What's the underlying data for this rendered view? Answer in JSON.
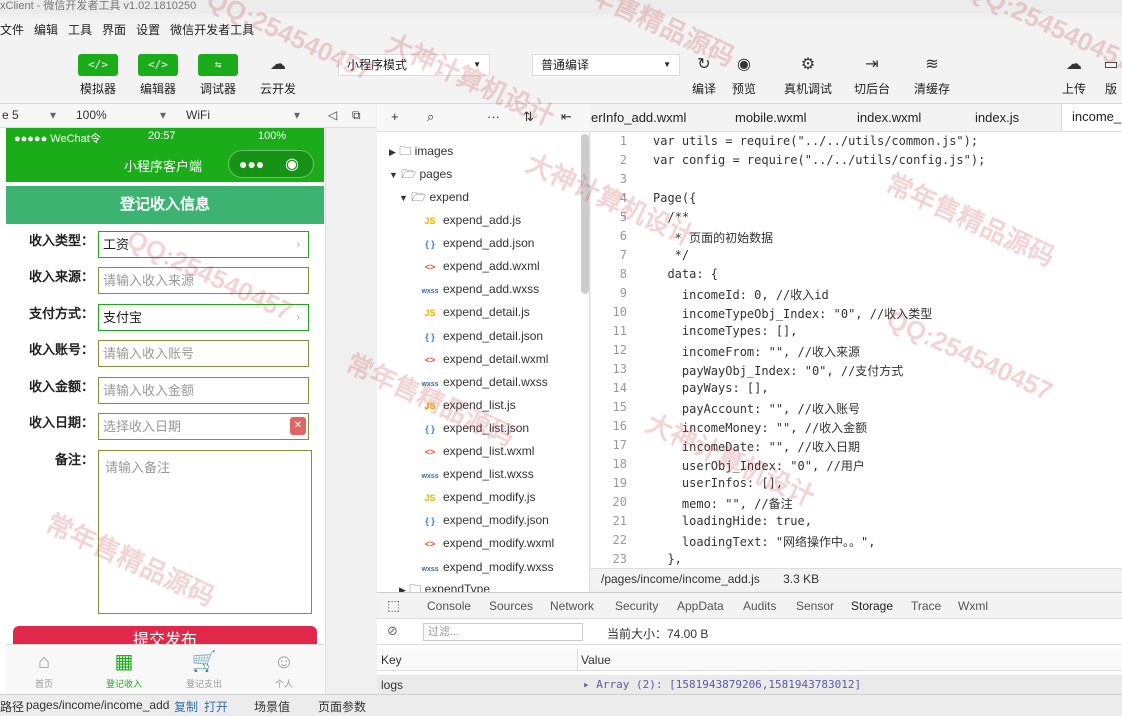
{
  "window": {
    "title": "xClient - 微信开发者工具 v1.02.1810250"
  },
  "menu": [
    "文件",
    "编辑",
    "工具",
    "界面",
    "设置",
    "微信开发者工具"
  ],
  "toolbar": {
    "buttons_left": [
      {
        "icon": "</>",
        "label": "模拟器"
      },
      {
        "icon": "</>",
        "label": "编辑器"
      },
      {
        "icon": "⇆",
        "label": "调试器"
      },
      {
        "icon": "☁",
        "label": "云开发"
      }
    ],
    "mode_select": "小程序模式",
    "compile_select": "普通编译",
    "buttons_right": [
      {
        "icon": "↻",
        "label": "编译"
      },
      {
        "icon": "◉",
        "label": "预览"
      },
      {
        "icon": "⚙",
        "label": "真机调试"
      },
      {
        "icon": "⇥",
        "label": "切后台"
      },
      {
        "icon": "≋",
        "label": "清缓存"
      },
      {
        "icon": "☁",
        "label": "上传"
      },
      {
        "icon": "",
        "label": "版"
      }
    ]
  },
  "device_bar": {
    "device": "e 5",
    "zoom": "100%",
    "network": "WiFi"
  },
  "simulator": {
    "status_left": "●●●●● WeChat令",
    "status_time": "20:57",
    "status_right": "100%",
    "nav_title": "小程序客户端",
    "header": "登记收入信息",
    "fields": [
      {
        "label": "收入类型：",
        "value": "工资",
        "placeholder": false,
        "arrow": true
      },
      {
        "label": "收入来源：",
        "value": "请输入收入来源",
        "placeholder": true,
        "arrow": false
      },
      {
        "label": "支付方式：",
        "value": "支付宝",
        "placeholder": false,
        "arrow": true
      },
      {
        "label": "收入账号：",
        "value": "请输入收入账号",
        "placeholder": true,
        "arrow": false
      },
      {
        "label": "收入金额：",
        "value": "请输入收入金额",
        "placeholder": true,
        "arrow": false
      },
      {
        "label": "收入日期：",
        "value": "选择收入日期",
        "placeholder": true,
        "arrow": false
      }
    ],
    "memo_label": "备注：",
    "memo_placeholder": "请输入备注",
    "submit": "提交发布",
    "tabs": [
      {
        "label": "首页",
        "icon": "⌂"
      },
      {
        "label": "登记收入",
        "icon": "▦"
      },
      {
        "label": "登记支出",
        "icon": "🛒"
      },
      {
        "label": "个人",
        "icon": "☺"
      }
    ]
  },
  "tree": {
    "toolbar": [
      "+",
      "⌕",
      "···",
      "⇅",
      "⇤"
    ],
    "folders": [
      {
        "name": "images",
        "open": false
      },
      {
        "name": "pages",
        "open": true
      },
      {
        "name": "expend",
        "open": true
      }
    ],
    "files": [
      {
        "type": "JS",
        "name": "expend_add.js"
      },
      {
        "type": "{ }",
        "name": "expend_add.json"
      },
      {
        "type": "<>",
        "name": "expend_add.wxml"
      },
      {
        "type": "wxss",
        "name": "expend_add.wxss"
      },
      {
        "type": "JS",
        "name": "expend_detail.js"
      },
      {
        "type": "{ }",
        "name": "expend_detail.json"
      },
      {
        "type": "<>",
        "name": "expend_detail.wxml"
      },
      {
        "type": "wxss",
        "name": "expend_detail.wxss"
      },
      {
        "type": "JS",
        "name": "expend_list.js"
      },
      {
        "type": "{ }",
        "name": "expend_list.json"
      },
      {
        "type": "<>",
        "name": "expend_list.wxml"
      },
      {
        "type": "wxss",
        "name": "expend_list.wxss"
      },
      {
        "type": "JS",
        "name": "expend_modify.js"
      },
      {
        "type": "{ }",
        "name": "expend_modify.json"
      },
      {
        "type": "<>",
        "name": "expend_modify.wxml"
      },
      {
        "type": "wxss",
        "name": "expend_modify.wxss"
      }
    ],
    "last_folder": "expendType"
  },
  "editor": {
    "tabs": [
      "erInfo_add.wxml",
      "mobile.wxml",
      "index.wxml",
      "index.js",
      "income_"
    ],
    "path": "/pages/income/income_add.js",
    "size": "3.3 KB"
  },
  "code_lines": [
    {
      "n": "1",
      "t": "var utils = require(\"../../utils/common.js\");"
    },
    {
      "n": "2",
      "t": "var config = require(\"../../utils/config.js\");"
    },
    {
      "n": "3",
      "t": ""
    },
    {
      "n": "4",
      "t": "Page({"
    },
    {
      "n": "5",
      "t": "  /**"
    },
    {
      "n": "6",
      "t": "   * 页面的初始数据"
    },
    {
      "n": "7",
      "t": "   */"
    },
    {
      "n": "8",
      "t": "  data: {"
    },
    {
      "n": "9",
      "t": "    incomeId: 0, //收入id"
    },
    {
      "n": "10",
      "t": "    incomeTypeObj_Index: \"0\", //收入类型"
    },
    {
      "n": "11",
      "t": "    incomeTypes: [],"
    },
    {
      "n": "12",
      "t": "    incomeFrom: \"\", //收入来源"
    },
    {
      "n": "13",
      "t": "    payWayObj_Index: \"0\", //支付方式"
    },
    {
      "n": "14",
      "t": "    payWays: [],"
    },
    {
      "n": "15",
      "t": "    payAccount: \"\", //收入账号"
    },
    {
      "n": "16",
      "t": "    incomeMoney: \"\", //收入金额"
    },
    {
      "n": "17",
      "t": "    incomeDate: \"\", //收入日期"
    },
    {
      "n": "18",
      "t": "    userObj_Index: \"0\", //用户"
    },
    {
      "n": "19",
      "t": "    userInfos: [],"
    },
    {
      "n": "20",
      "t": "    memo: \"\", //备注"
    },
    {
      "n": "21",
      "t": "    loadingHide: true,"
    },
    {
      "n": "22",
      "t": "    loadingText: \"网络操作中。。\","
    },
    {
      "n": "23",
      "t": "  },"
    }
  ],
  "devtools": {
    "tabs": [
      "Console",
      "Sources",
      "Network",
      "Security",
      "AppData",
      "Audits",
      "Sensor",
      "Storage",
      "Trace",
      "Wxml"
    ],
    "active_tab": "Storage",
    "filter_placeholder": "过滤...",
    "current_size": "当前大小：74.00 B",
    "col_key": "Key",
    "col_value": "Value",
    "row_key": "logs",
    "row_value": "▸ Array (2): [1581943879206,1581943783012]"
  },
  "statusbar": {
    "path_label": "路径",
    "path": "pages/income/income_add",
    "copy": "复制",
    "open": "打开",
    "scene": "场景值",
    "params": "页面参数"
  },
  "watermarks": [
    "QQ:254540457",
    "大神计算机设计",
    "常年售精品源码",
    "QQ:254540457",
    "常年售精品源码",
    "大神计算机设计",
    "QQ:254540457",
    "常年售精品源码",
    "大神计算机设计",
    "QQ:254540457",
    "常年售精品源码"
  ],
  "colors": {
    "wechat_green": "#1aad19",
    "header_green": "#3cb371",
    "submit_red": "#e0294a"
  }
}
